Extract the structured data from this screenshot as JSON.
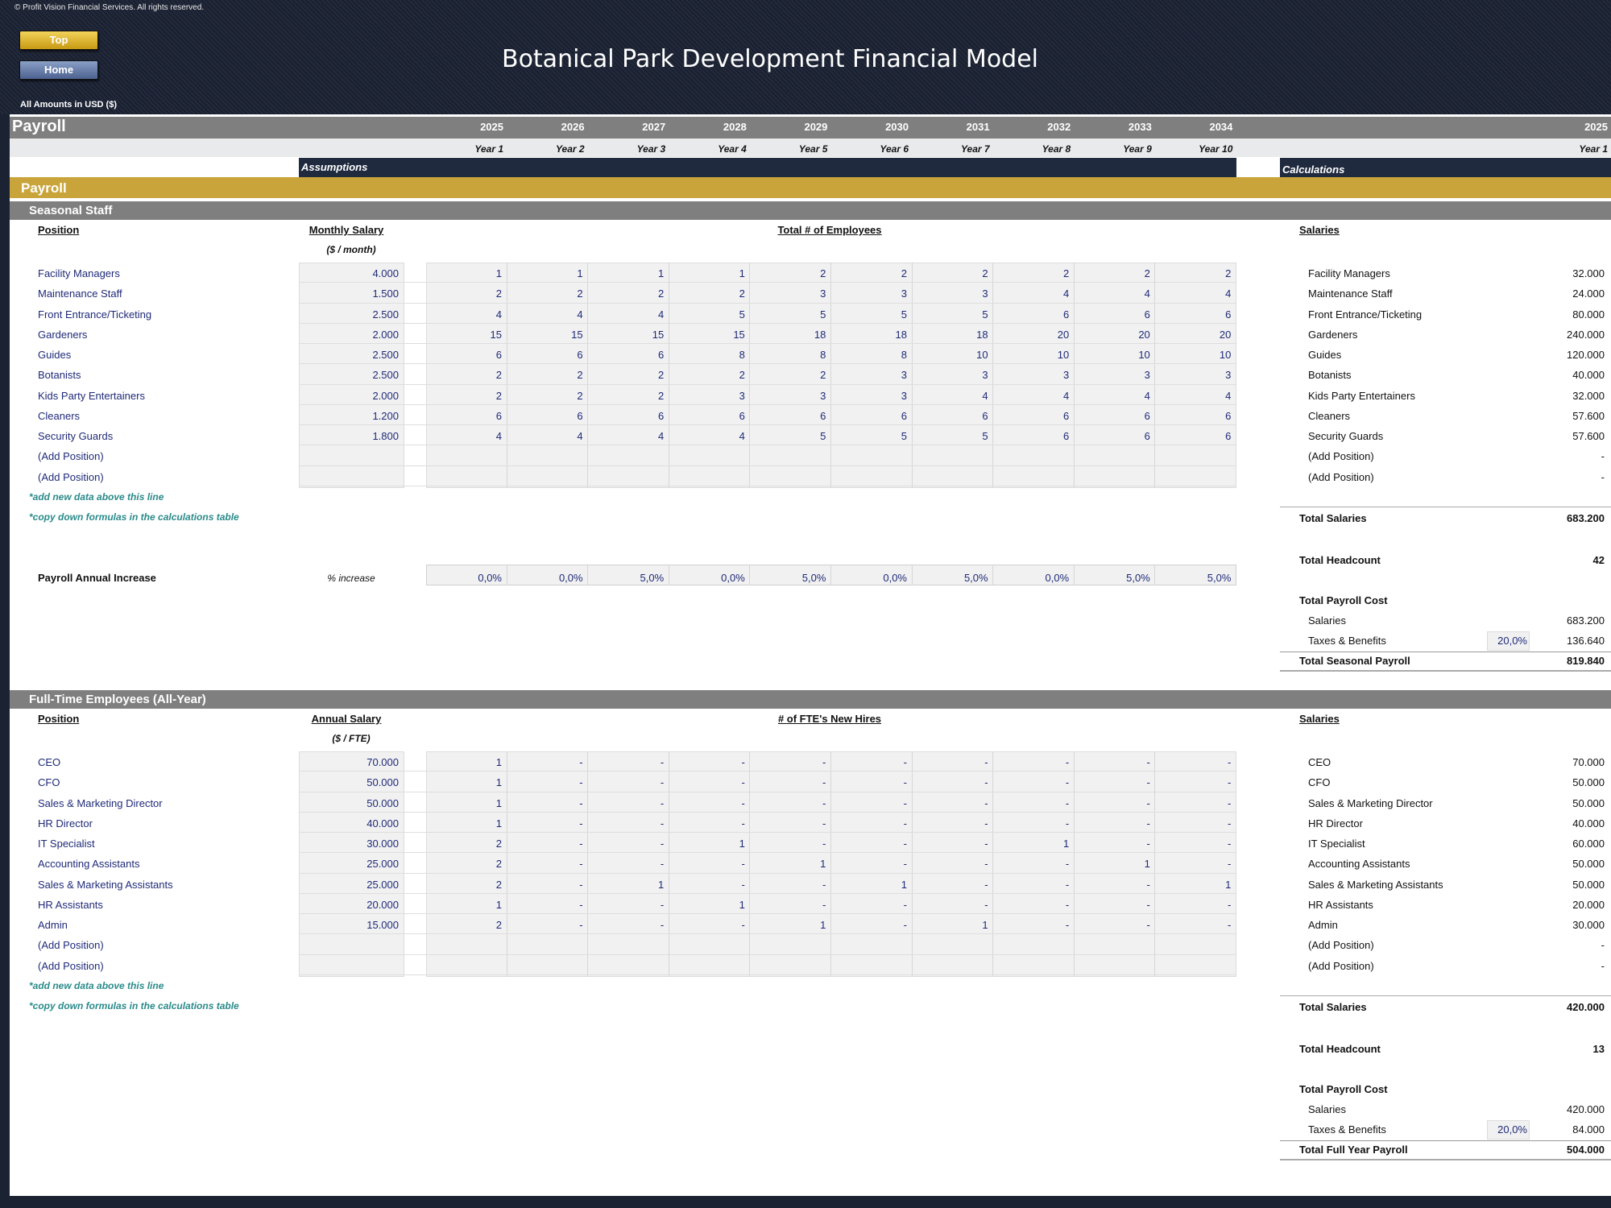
{
  "copyright": "© Profit Vision Financial Services. All rights reserved.",
  "nav": {
    "top": "Top",
    "home": "Home"
  },
  "title": "Botanical Park Development Financial Model",
  "amounts_label": "All Amounts in  USD ($)",
  "sheet_title": "Payroll",
  "years": [
    "2025",
    "2026",
    "2027",
    "2028",
    "2029",
    "2030",
    "2031",
    "2032",
    "2033",
    "2034"
  ],
  "year_labels": [
    "Year 1",
    "Year 2",
    "Year 3",
    "Year 4",
    "Year 5",
    "Year 6",
    "Year 7",
    "Year 8",
    "Year 9",
    "Year 10"
  ],
  "calc_year": "2025",
  "calc_year_label": "Year 1",
  "assumptions_label": "Assumptions",
  "calculations_label": "Calculations",
  "section_title": "Payroll",
  "colors": {
    "gold": "#c9a43a",
    "navy_band": "#1f2a3f",
    "gray_band": "#7f7f7f",
    "navy_text": "#1f2a78",
    "teal_note": "#2b8a8a"
  },
  "seasonal": {
    "title": "Seasonal Staff",
    "position_header": "Position",
    "salary_header": "Monthly Salary",
    "salary_unit": "($ / month)",
    "employees_header": "Total # of Employees",
    "salaries_header": "Salaries",
    "rows": [
      {
        "position": "Facility Managers",
        "salary": "4.000",
        "counts": [
          "1",
          "1",
          "1",
          "1",
          "2",
          "2",
          "2",
          "2",
          "2",
          "2"
        ],
        "calc": "32.000"
      },
      {
        "position": "Maintenance Staff",
        "salary": "1.500",
        "counts": [
          "2",
          "2",
          "2",
          "2",
          "3",
          "3",
          "3",
          "4",
          "4",
          "4"
        ],
        "calc": "24.000"
      },
      {
        "position": "Front Entrance/Ticketing",
        "salary": "2.500",
        "counts": [
          "4",
          "4",
          "4",
          "5",
          "5",
          "5",
          "5",
          "6",
          "6",
          "6"
        ],
        "calc": "80.000"
      },
      {
        "position": "Gardeners",
        "salary": "2.000",
        "counts": [
          "15",
          "15",
          "15",
          "15",
          "18",
          "18",
          "18",
          "20",
          "20",
          "20"
        ],
        "calc": "240.000"
      },
      {
        "position": "Guides",
        "salary": "2.500",
        "counts": [
          "6",
          "6",
          "6",
          "8",
          "8",
          "8",
          "10",
          "10",
          "10",
          "10"
        ],
        "calc": "120.000"
      },
      {
        "position": "Botanists",
        "salary": "2.500",
        "counts": [
          "2",
          "2",
          "2",
          "2",
          "2",
          "3",
          "3",
          "3",
          "3",
          "3"
        ],
        "calc": "40.000"
      },
      {
        "position": "Kids Party Entertainers",
        "salary": "2.000",
        "counts": [
          "2",
          "2",
          "2",
          "3",
          "3",
          "3",
          "4",
          "4",
          "4",
          "4"
        ],
        "calc": "32.000"
      },
      {
        "position": "Cleaners",
        "salary": "1.200",
        "counts": [
          "6",
          "6",
          "6",
          "6",
          "6",
          "6",
          "6",
          "6",
          "6",
          "6"
        ],
        "calc": "57.600"
      },
      {
        "position": "Security Guards",
        "salary": "1.800",
        "counts": [
          "4",
          "4",
          "4",
          "4",
          "5",
          "5",
          "5",
          "6",
          "6",
          "6"
        ],
        "calc": "57.600"
      },
      {
        "position": "(Add Position)",
        "salary": "",
        "counts": [
          "",
          "",
          "",
          "",
          "",
          "",
          "",
          "",
          "",
          ""
        ],
        "calc": "-"
      },
      {
        "position": "(Add Position)",
        "salary": "",
        "counts": [
          "",
          "",
          "",
          "",
          "",
          "",
          "",
          "",
          "",
          ""
        ],
        "calc": "-"
      }
    ],
    "note1": "*add new data above this line",
    "note2": "*copy down formulas in the calculations table",
    "increase_label": "Payroll Annual Increase",
    "increase_unit": "% increase",
    "increases": [
      "0,0%",
      "0,0%",
      "5,0%",
      "0,0%",
      "5,0%",
      "0,0%",
      "5,0%",
      "0,0%",
      "5,0%",
      "5,0%"
    ],
    "total_salaries_label": "Total Salaries",
    "total_salaries": "683.200",
    "total_headcount_label": "Total Headcount",
    "total_headcount": "42",
    "total_payroll_cost_label": "Total Payroll Cost",
    "salaries_label": "Salaries",
    "salaries_value": "683.200",
    "taxes_label": "Taxes & Benefits",
    "taxes_pct": "20,0%",
    "taxes_value": "136.640",
    "grand_total_label": "Total Seasonal Payroll",
    "grand_total": "819.840"
  },
  "fulltime": {
    "title": "Full-Time Employees (All-Year)",
    "position_header": "Position",
    "salary_header": "Annual Salary",
    "salary_unit": "($ / FTE)",
    "employees_header": "# of FTE's New Hires",
    "salaries_header": "Salaries",
    "rows": [
      {
        "position": "CEO",
        "salary": "70.000",
        "counts": [
          "1",
          "-",
          "-",
          "-",
          "-",
          "-",
          "-",
          "-",
          "-",
          "-"
        ],
        "calc": "70.000"
      },
      {
        "position": "CFO",
        "salary": "50.000",
        "counts": [
          "1",
          "-",
          "-",
          "-",
          "-",
          "-",
          "-",
          "-",
          "-",
          "-"
        ],
        "calc": "50.000"
      },
      {
        "position": "Sales & Marketing Director",
        "salary": "50.000",
        "counts": [
          "1",
          "-",
          "-",
          "-",
          "-",
          "-",
          "-",
          "-",
          "-",
          "-"
        ],
        "calc": "50.000"
      },
      {
        "position": "HR Director",
        "salary": "40.000",
        "counts": [
          "1",
          "-",
          "-",
          "-",
          "-",
          "-",
          "-",
          "-",
          "-",
          "-"
        ],
        "calc": "40.000"
      },
      {
        "position": "IT Specialist",
        "salary": "30.000",
        "counts": [
          "2",
          "-",
          "-",
          "1",
          "-",
          "-",
          "-",
          "1",
          "-",
          "-"
        ],
        "calc": "60.000"
      },
      {
        "position": "Accounting Assistants",
        "salary": "25.000",
        "counts": [
          "2",
          "-",
          "-",
          "-",
          "1",
          "-",
          "-",
          "-",
          "1",
          "-"
        ],
        "calc": "50.000"
      },
      {
        "position": "Sales & Marketing Assistants",
        "salary": "25.000",
        "counts": [
          "2",
          "-",
          "1",
          "-",
          "-",
          "1",
          "-",
          "-",
          "-",
          "1"
        ],
        "calc": "50.000"
      },
      {
        "position": "HR Assistants",
        "salary": "20.000",
        "counts": [
          "1",
          "-",
          "-",
          "1",
          "-",
          "-",
          "-",
          "-",
          "-",
          "-"
        ],
        "calc": "20.000"
      },
      {
        "position": "Admin",
        "salary": "15.000",
        "counts": [
          "2",
          "-",
          "-",
          "-",
          "1",
          "-",
          "1",
          "-",
          "-",
          "-"
        ],
        "calc": "30.000"
      },
      {
        "position": "(Add Position)",
        "salary": "",
        "counts": [
          "",
          "",
          "",
          "",
          "",
          "",
          "",
          "",
          "",
          ""
        ],
        "calc": "-"
      },
      {
        "position": "(Add Position)",
        "salary": "",
        "counts": [
          "",
          "",
          "",
          "",
          "",
          "",
          "",
          "",
          "",
          ""
        ],
        "calc": "-"
      }
    ],
    "note1": "*add new data above this line",
    "note2": "*copy down formulas in the calculations table",
    "total_salaries_label": "Total Salaries",
    "total_salaries": "420.000",
    "total_headcount_label": "Total Headcount",
    "total_headcount": "13",
    "total_payroll_cost_label": "Total Payroll Cost",
    "salaries_label": "Salaries",
    "salaries_value": "420.000",
    "taxes_label": "Taxes & Benefits",
    "taxes_pct": "20,0%",
    "taxes_value": "84.000",
    "grand_total_label": "Total Full Year Payroll",
    "grand_total": "504.000"
  }
}
